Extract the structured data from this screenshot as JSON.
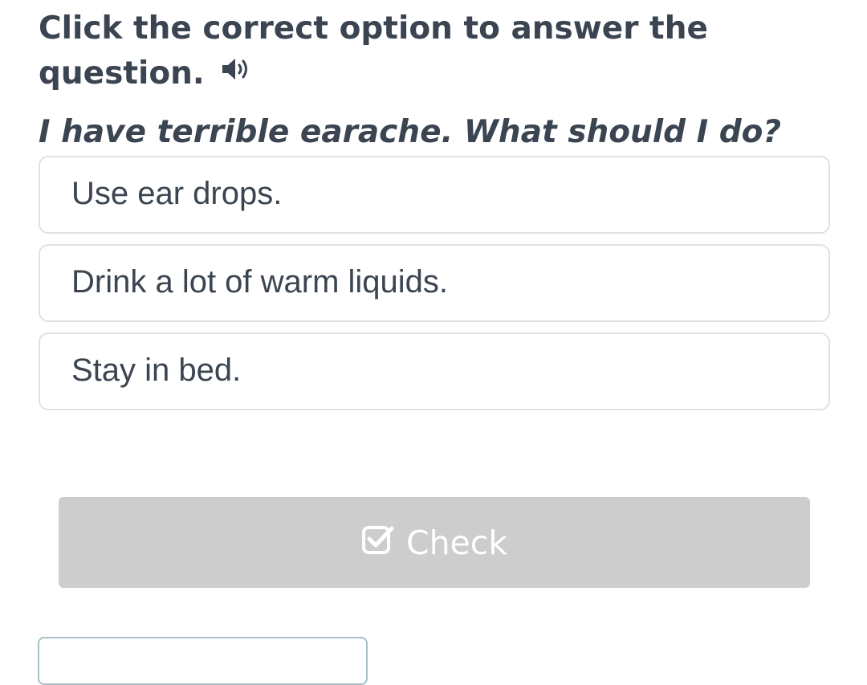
{
  "instruction": {
    "text": "Click the correct option to answer the question.",
    "audio_icon": "speaker-icon"
  },
  "question": {
    "text": "I have terrible earache. What should I do?"
  },
  "options": [
    {
      "label": "Use ear drops."
    },
    {
      "label": "Drink a lot of warm liquids."
    },
    {
      "label": "Stay in bed."
    }
  ],
  "check_button": {
    "label": "Check",
    "icon": "checkbox-checked-icon",
    "state": "disabled"
  },
  "colors": {
    "text": "#3b4451",
    "option_border": "#dde2e6",
    "button_disabled_bg": "#cdcdcd",
    "button_text": "#ffffff"
  }
}
